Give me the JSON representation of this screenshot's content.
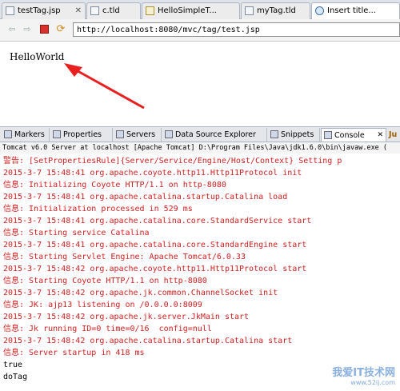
{
  "editor_tabs": [
    {
      "label": "testTag.jsp",
      "icon": "jsp-file-icon",
      "active": false
    },
    {
      "label": "c.tld",
      "icon": "tld-file-icon",
      "active": false
    },
    {
      "label": "HelloSimpleT...",
      "icon": "java-file-icon",
      "active": false
    },
    {
      "label": "myTag.tld",
      "icon": "tld-file-icon",
      "active": false
    },
    {
      "label": "Insert title...",
      "icon": "web-browser-icon",
      "active": true
    }
  ],
  "toolbar": {
    "url": "http://localhost:8080/mvc/tag/test.jsp"
  },
  "browser": {
    "content": "HelloWorld"
  },
  "views": [
    {
      "label": "Markers",
      "active": false
    },
    {
      "label": "Properties",
      "active": false
    },
    {
      "label": "Servers",
      "active": false
    },
    {
      "label": "Data Source Explorer",
      "active": false
    },
    {
      "label": "Snippets",
      "active": false
    },
    {
      "label": "Console",
      "active": true
    },
    {
      "label": "Ju",
      "active": false
    }
  ],
  "console": {
    "header": "Tomcat v6.0 Server at localhost [Apache Tomcat] D:\\Program Files\\Java\\jdk1.6.0\\bin\\javaw.exe (",
    "lines": [
      "警告: [SetPropertiesRule]{Server/Service/Engine/Host/Context} Setting p",
      "2015-3-7 15:48:41 org.apache.coyote.http11.Http11Protocol init",
      "信息: Initializing Coyote HTTP/1.1 on http-8080",
      "2015-3-7 15:48:41 org.apache.catalina.startup.Catalina load",
      "信息: Initialization processed in 529 ms",
      "2015-3-7 15:48:41 org.apache.catalina.core.StandardService start",
      "信息: Starting service Catalina",
      "2015-3-7 15:48:41 org.apache.catalina.core.StandardEngine start",
      "信息: Starting Servlet Engine: Apache Tomcat/6.0.33",
      "2015-3-7 15:48:42 org.apache.coyote.http11.Http11Protocol start",
      "信息: Starting Coyote HTTP/1.1 on http-8080",
      "2015-3-7 15:48:42 org.apache.jk.common.ChannelSocket init",
      "信息: JK: ajp13 listening on /0.0.0.0:8009",
      "2015-3-7 15:48:42 org.apache.jk.server.JkMain start",
      "信息: Jk running ID=0 time=0/16  config=null",
      "2015-3-7 15:48:42 org.apache.catalina.startup.Catalina start",
      "信息: Server startup in 418 ms"
    ],
    "output": [
      "true",
      "doTag"
    ]
  },
  "watermark": {
    "text": "我爱IT技术网",
    "url": "www.52ij.com"
  },
  "colors": {
    "stderr": "#d02020",
    "stdout": "#000000",
    "annotation_arrow": "#e82020"
  }
}
